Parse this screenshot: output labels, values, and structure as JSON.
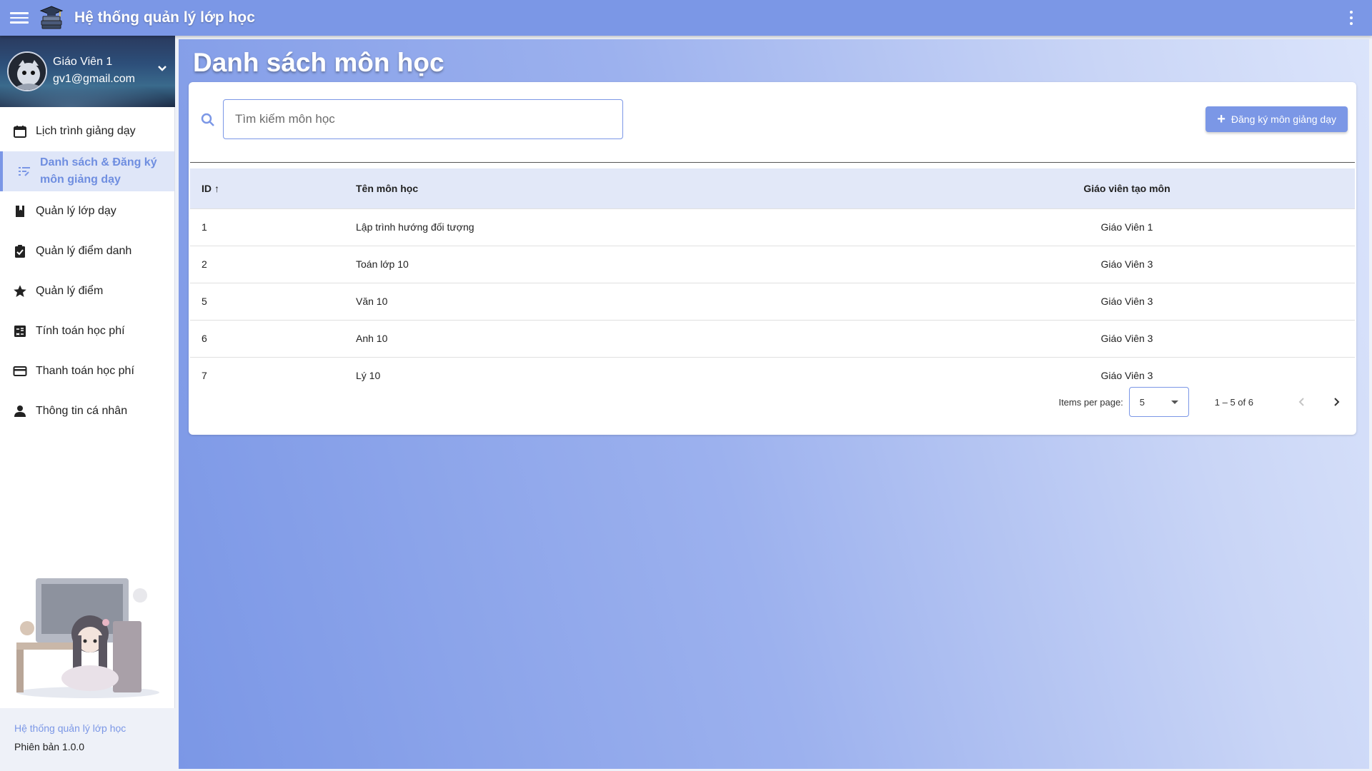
{
  "app": {
    "title": "Hệ thống quản lý lớp học"
  },
  "profile": {
    "name": "Giáo Viên 1",
    "email": "gv1@gmail.com"
  },
  "sidebar": {
    "items": [
      {
        "label": "Lịch trình giảng dạy",
        "icon": "calendar-icon",
        "active": false
      },
      {
        "label": "Danh sách & Đăng ký môn giảng dạy",
        "icon": "list-icon",
        "active": true
      },
      {
        "label": "Quản lý lớp dạy",
        "icon": "book-icon",
        "active": false
      },
      {
        "label": "Quản lý điểm danh",
        "icon": "assignment-check-icon",
        "active": false
      },
      {
        "label": "Quản lý điểm",
        "icon": "star-icon",
        "active": false
      },
      {
        "label": "Tính toán học phí",
        "icon": "calculate-icon",
        "active": false
      },
      {
        "label": "Thanh toán học phí",
        "icon": "credit-card-icon",
        "active": false
      },
      {
        "label": "Thông tin cá nhân",
        "icon": "person-icon",
        "active": false
      }
    ],
    "footer": {
      "app_name": "Hệ thống quản lý lớp học",
      "version": "Phiên bản 1.0.0"
    }
  },
  "main": {
    "page_title": "Danh sách môn học",
    "search": {
      "placeholder": "Tìm kiếm môn học",
      "value": ""
    },
    "register_button": "Đăng ký môn giảng dạy",
    "table": {
      "headers": {
        "id": "ID",
        "name": "Tên môn học",
        "teacher": "Giáo viên tạo môn"
      },
      "sort": {
        "column": "id",
        "direction": "asc"
      },
      "rows": [
        {
          "id": "1",
          "name": "Lập trình hướng đối tượng",
          "teacher": "Giáo Viên 1"
        },
        {
          "id": "2",
          "name": "Toán lớp 10",
          "teacher": "Giáo Viên 3"
        },
        {
          "id": "5",
          "name": "Văn 10",
          "teacher": "Giáo Viên 3"
        },
        {
          "id": "6",
          "name": "Anh 10",
          "teacher": "Giáo Viên 3"
        },
        {
          "id": "7",
          "name": "Lý 10",
          "teacher": "Giáo Viên 3"
        }
      ]
    },
    "paginator": {
      "items_per_page_label": "Items per page:",
      "items_per_page": "5",
      "range": "1 – 5 of 6"
    }
  },
  "colors": {
    "primary": "#7b97e6",
    "active_bg": "#dfe6f8",
    "header_row": "#e2e8f8"
  }
}
